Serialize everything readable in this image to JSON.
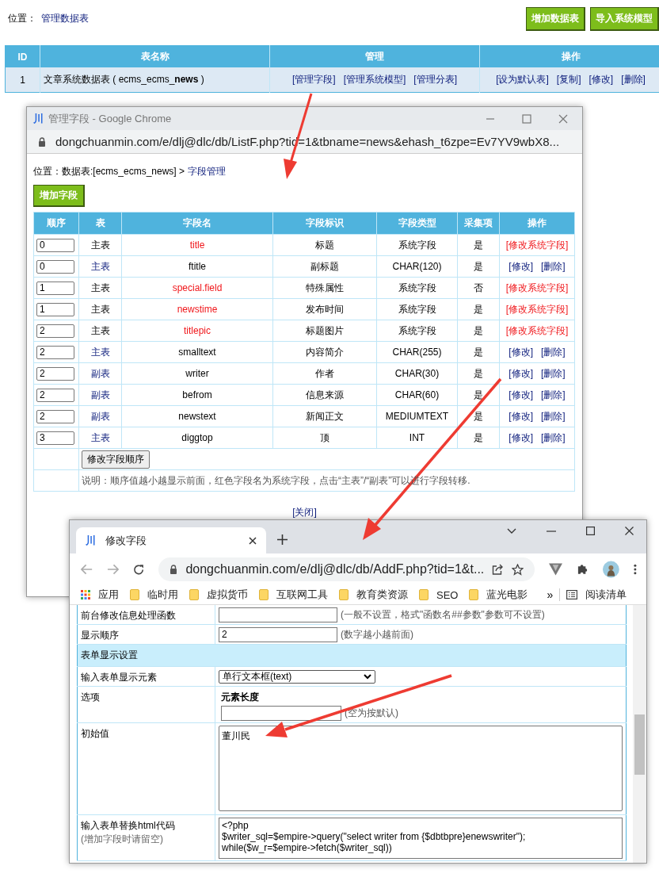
{
  "page": {
    "location_label": "位置：",
    "location_link": "管理数据表",
    "buttons": [
      "增加数据表",
      "导入系统模型"
    ]
  },
  "table": {
    "columns": [
      "ID",
      "表名称",
      "管理",
      "操作"
    ],
    "rows": [
      {
        "id": "1",
        "name": "文章系统数据表 ( ecms_ecms_**news** )",
        "manage_links": [
          "[管理字段]",
          "[管理系统模型]",
          "[管理分表]"
        ],
        "action_links": [
          "[设为默认表]",
          "[复制]",
          "[修改]",
          "[删除]"
        ]
      }
    ]
  },
  "field_window": {
    "favicon": "川",
    "title": "管理字段 - Google Chrome",
    "url": "dongchuanmin.com/e/dlj@dlc/db/ListF.php?tid=1&tbname=news&ehash_t6zpe=Ev7YV9wbX8...",
    "breadcrumb_label": "位置：数据表:[ecms_ecms_news] > ",
    "breadcrumb_link": "字段管理",
    "add_button": "增加字段",
    "columns": [
      "顺序",
      "表",
      "字段名",
      "字段标识",
      "字段类型",
      "采集项",
      "操作"
    ],
    "rows": [
      {
        "order": "0",
        "table": "主表",
        "name": "title",
        "system": true,
        "label": "标题",
        "type": "系统字段",
        "collect": "是",
        "actions": [
          "[修改系统字段]"
        ]
      },
      {
        "order": "0",
        "table": "主表",
        "name": "ftitle",
        "system": false,
        "label": "副标题",
        "type": "CHAR(120)",
        "collect": "是",
        "actions": [
          "[修改]",
          "[删除]"
        ]
      },
      {
        "order": "1",
        "table": "主表",
        "name": "special.field",
        "system": true,
        "label": "特殊属性",
        "type": "系统字段",
        "collect": "否",
        "actions": [
          "[修改系统字段]"
        ]
      },
      {
        "order": "1",
        "table": "主表",
        "name": "newstime",
        "system": true,
        "label": "发布时间",
        "type": "系统字段",
        "collect": "是",
        "actions": [
          "[修改系统字段]"
        ]
      },
      {
        "order": "2",
        "table": "主表",
        "name": "titlepic",
        "system": true,
        "label": "标题图片",
        "type": "系统字段",
        "collect": "是",
        "actions": [
          "[修改系统字段]"
        ]
      },
      {
        "order": "2",
        "table": "主表",
        "name": "smalltext",
        "system": false,
        "label": "内容简介",
        "type": "CHAR(255)",
        "collect": "是",
        "actions": [
          "[修改]",
          "[删除]"
        ]
      },
      {
        "order": "2",
        "table": "副表",
        "name": "writer",
        "system": false,
        "label": "作者",
        "type": "CHAR(30)",
        "collect": "是",
        "actions": [
          "[修改]",
          "[删除]"
        ]
      },
      {
        "order": "2",
        "table": "副表",
        "name": "befrom",
        "system": false,
        "label": "信息来源",
        "type": "CHAR(60)",
        "collect": "是",
        "actions": [
          "[修改]",
          "[删除]"
        ]
      },
      {
        "order": "2",
        "table": "副表",
        "name": "newstext",
        "system": false,
        "label": "新闻正文",
        "type": "MEDIUMTEXT",
        "collect": "是",
        "actions": [
          "[修改]",
          "[删除]"
        ]
      },
      {
        "order": "3",
        "table": "主表",
        "name": "diggtop",
        "system": false,
        "label": "顶",
        "type": "INT",
        "collect": "是",
        "actions": [
          "[修改]",
          "[删除]"
        ]
      }
    ],
    "order_button": "修改字段顺序",
    "note": "说明：顺序值越小越显示前面，红色字段名为系统字段，点击“主表”/“副表”可以进行字段转移.",
    "close_link": "[关闭]"
  },
  "edit_window": {
    "favicon": "川",
    "tab_title": "修改字段",
    "url": "dongchuanmin.com/e/dlj@dlc/db/AddF.php?tid=1&t...",
    "bookmarks": [
      {
        "label": "应用",
        "kind": "apps"
      },
      {
        "label": "临时用",
        "kind": "folder"
      },
      {
        "label": "虚拟货币",
        "kind": "folder"
      },
      {
        "label": "互联网工具",
        "kind": "folder"
      },
      {
        "label": "教育类资源",
        "kind": "folder"
      },
      {
        "label": "SEO",
        "kind": "folder"
      },
      {
        "label": "蓝光电影",
        "kind": "folder"
      }
    ],
    "more": "»",
    "reading_list": "阅读清单",
    "form": [
      {
        "kind": "input",
        "label": "前台修改信息处理函数",
        "hint": "(一般不设置，格式\"函数名##参数\"参数可不设置)"
      },
      {
        "kind": "input",
        "label": "显示顺序",
        "value": "2",
        "hint": "(数字越小越前面)"
      },
      {
        "kind": "section",
        "label": "表单显示设置"
      },
      {
        "kind": "select",
        "label": "输入表单显示元素",
        "value": "单行文本框(text)"
      },
      {
        "kind": "options",
        "label": "选项",
        "title": "元素长度",
        "hint": "(空为按默认)"
      },
      {
        "kind": "textarea",
        "label": "初始值",
        "value": "董川民"
      },
      {
        "kind": "code",
        "label": "输入表单替换html代码",
        "sublabel": "(增加字段时请留空)",
        "lines": [
          "<?php",
          "$writer_sql=$empire->query(\"select writer from {$dbtbpre}enewswriter\");",
          "while($w_r=$empire->fetch($writer_sql))"
        ]
      }
    ]
  }
}
